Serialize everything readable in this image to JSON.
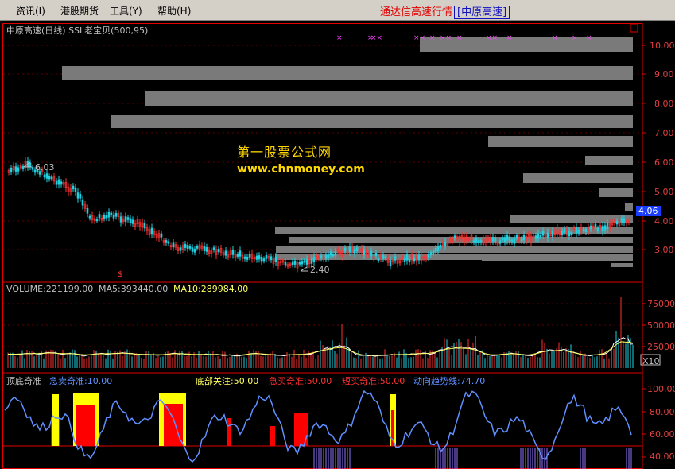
{
  "menu": {
    "items": [
      "资讯(I)",
      "港股期货",
      "工具(Y)",
      "帮助(H)"
    ],
    "brand_main": "通达信高速行情",
    "brand_sub": "[中原高速]"
  },
  "main_panel": {
    "title": "中原高速(日线) SSL老宝贝(500,95)",
    "price_axis": [
      "10.00",
      "9.00",
      "8.00",
      "7.00",
      "6.00",
      "5.00",
      "4.00",
      "3.00"
    ],
    "current_price": "4.06",
    "high_marker": "6.03",
    "low_marker": "2.40",
    "watermark_cn": "第一股票公式网",
    "watermark_url": "www.chnmoney.com"
  },
  "volume_panel": {
    "volume": "VOLUME:221199.00",
    "ma5": "MA5:393440.00",
    "ma10": "MA10:289984.00",
    "axis": [
      "75000",
      "50000",
      "25000"
    ],
    "unit": "X10"
  },
  "indicator_panel": {
    "name": "顶底奇准",
    "jmai": "急卖奇准:10.00",
    "dibu": "底部关注:50.00",
    "jimai": "急买奇准:50.00",
    "duanmai": "短买奇准:50.00",
    "trend": "动向趋势线:74.70",
    "axis": [
      "100.00",
      "80.00",
      "60.00",
      "40.00"
    ]
  },
  "colors": {
    "background": "#000000",
    "up": "#ff3030",
    "down": "#20d0e0",
    "bar_gray": "#808080",
    "red_line": "#e00000",
    "trend_blue": "#6090ff",
    "yellow": "#ffff00",
    "magenta": "#ff40ff"
  }
}
